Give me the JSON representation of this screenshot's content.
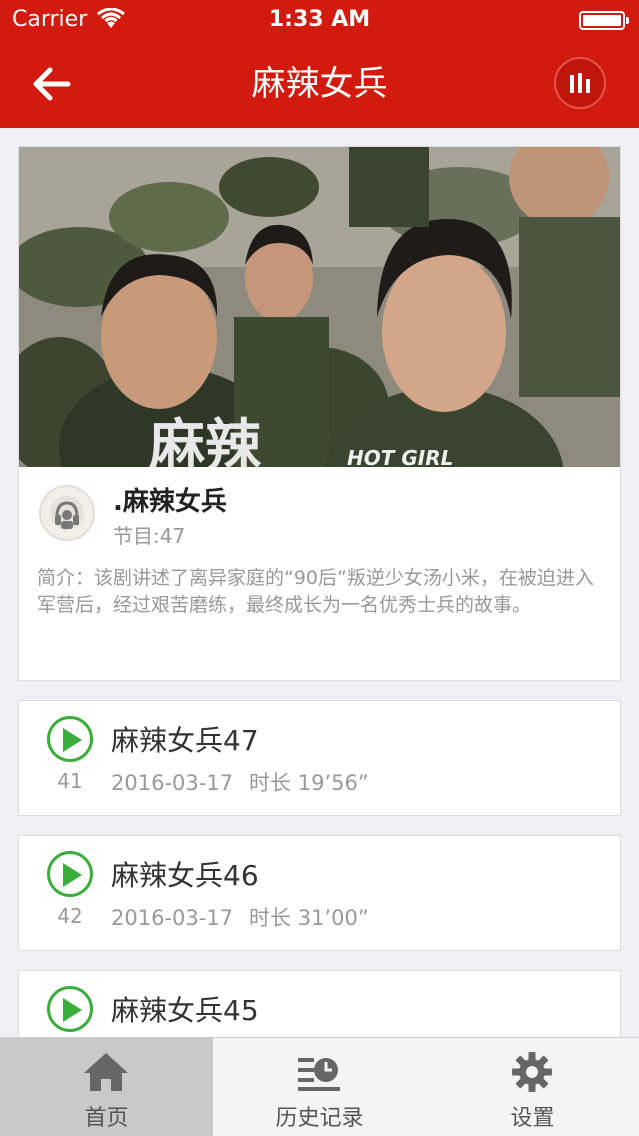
{
  "status_bar": {
    "carrier": "Carrier",
    "time": "1:33 AM"
  },
  "nav": {
    "title": "麻辣女兵",
    "back_icon": "back-arrow-icon",
    "player_icon": "equalizer-icon"
  },
  "colors": {
    "brand": "#d21a0e",
    "play": "#3aae3a",
    "muted_text": "#999999"
  },
  "show": {
    "poster_text": "HOT GIRL",
    "poster_title": "麻辣",
    "title": ".麻辣女兵",
    "count": "节目:47",
    "description": "简介：该剧讲述了离异家庭的“90后”叛逆少女汤小米，在被迫进入军营后，经过艰苦磨练，最终成长为一名优秀士兵的故事。"
  },
  "episodes": [
    {
      "title": "麻辣女兵47",
      "plays": "41",
      "date": "2016-03-17",
      "duration": "时长 19’56”"
    },
    {
      "title": "麻辣女兵46",
      "plays": "42",
      "date": "2016-03-17",
      "duration": "时长 31’00”"
    },
    {
      "title": "麻辣女兵45"
    }
  ],
  "tabs": [
    {
      "label": "首页",
      "icon": "home-icon",
      "active": true
    },
    {
      "label": "历史记录",
      "icon": "history-icon",
      "active": false
    },
    {
      "label": "设置",
      "icon": "gear-icon",
      "active": false
    }
  ]
}
